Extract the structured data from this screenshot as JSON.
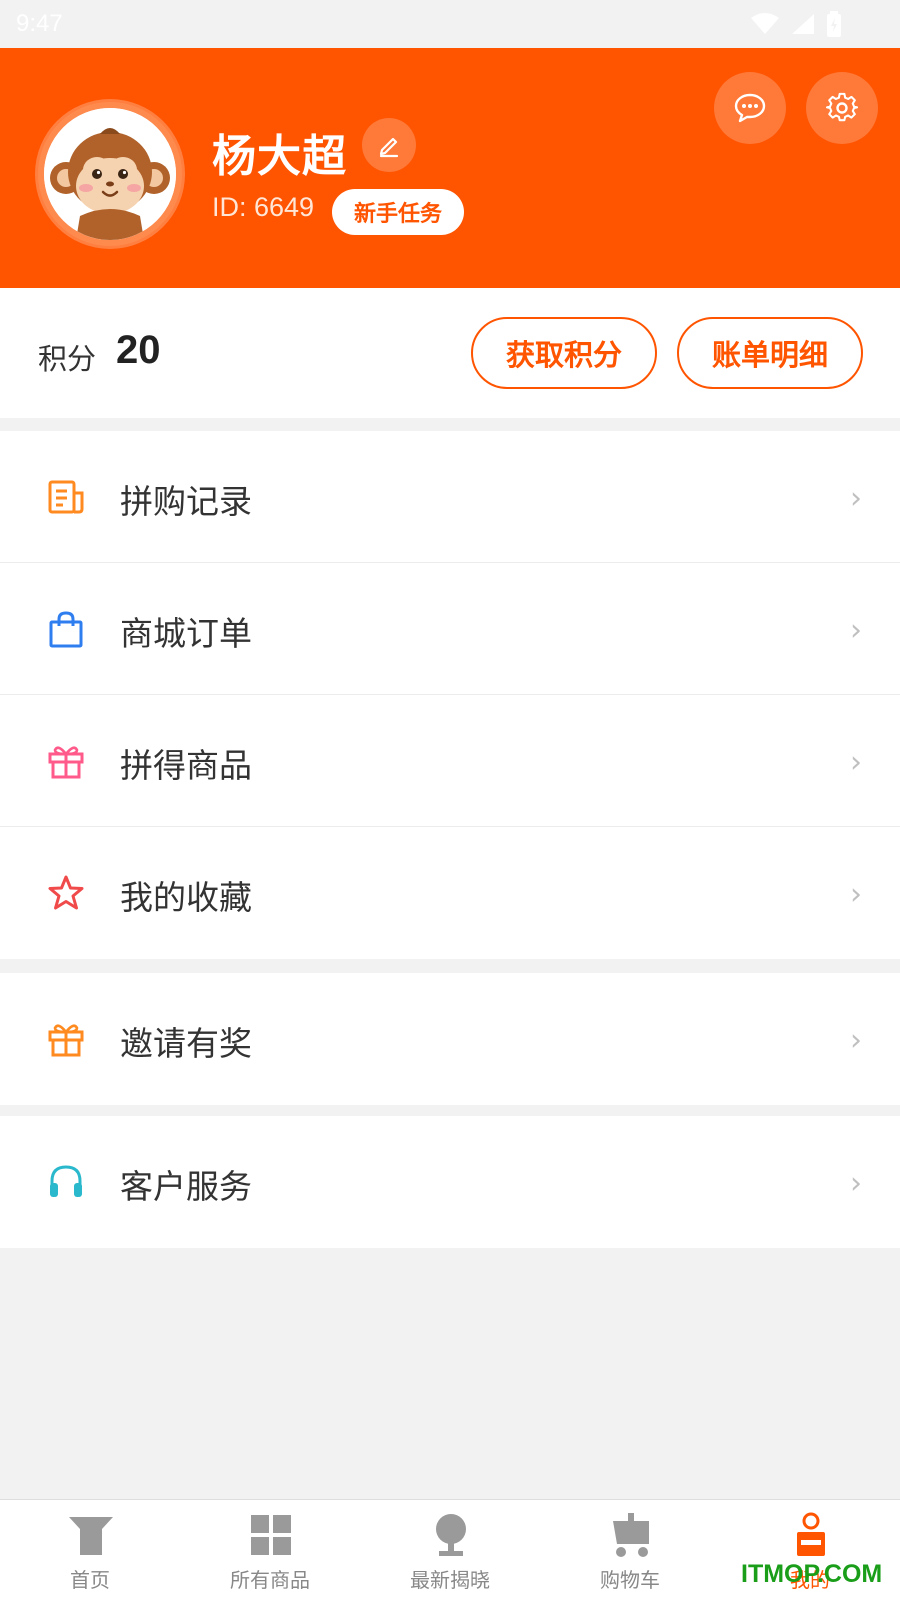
{
  "status_bar": {
    "time": "9:47"
  },
  "profile": {
    "name": "杨大超",
    "id_text": "ID: 6649",
    "task_button": "新手任务"
  },
  "points": {
    "label": "积分",
    "value": "20",
    "get_button": "获取积分",
    "bill_button": "账单明细"
  },
  "menu": {
    "group1": [
      {
        "label": "拼购记录",
        "icon": "document-icon",
        "color": "#ff8a1f"
      },
      {
        "label": "商城订单",
        "icon": "shopping-bag-icon",
        "color": "#2f7ef0"
      },
      {
        "label": "拼得商品",
        "icon": "gift-icon",
        "color": "#ff5a8a"
      },
      {
        "label": "我的收藏",
        "icon": "star-icon",
        "color": "#f04a4a"
      }
    ],
    "group2": [
      {
        "label": "邀请有奖",
        "icon": "gift-icon",
        "color": "#ff8a1f"
      }
    ],
    "group3": [
      {
        "label": "客户服务",
        "icon": "headset-icon",
        "color": "#2ab8cc"
      }
    ],
    "chevron": "›"
  },
  "tabs": [
    {
      "label": "首页",
      "icon": "home-icon"
    },
    {
      "label": "所有商品",
      "icon": "grid-icon"
    },
    {
      "label": "最新揭晓",
      "icon": "trophy-icon"
    },
    {
      "label": "购物车",
      "icon": "cart-icon"
    },
    {
      "label": "我的",
      "icon": "person-icon",
      "active": true
    }
  ],
  "watermark": "ITMOP.COM",
  "colors": {
    "brand": "#ff5400",
    "tab_inactive": "#888888"
  }
}
